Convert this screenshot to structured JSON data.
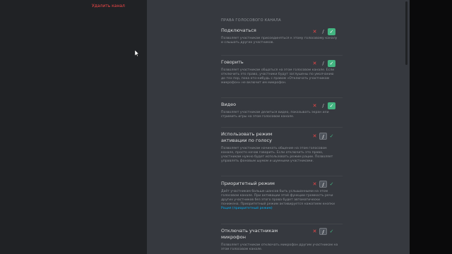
{
  "sidebar": {
    "delete_channel_label": "Удалить канал"
  },
  "section": {
    "title": "Права голосового канала"
  },
  "permissions": [
    {
      "title": "Подключаться",
      "description": "Позволяет участникам присоединяться к этому голосовому каналу и слышать других участников.",
      "state": "allow"
    },
    {
      "title": "Говорить",
      "description": "Позволяет участникам общаться на этом голосовом канале. Если отключить это право, участники будут заглушены по умолчанию до тех пор, пока кто-нибудь с правом «Отключать участникам микрофон» не включит им микрофон.",
      "state": "allow"
    },
    {
      "title": "Видео",
      "description": "Позволяет участникам делиться видео, показывать экран или стримить игры на этом голосовом канале.",
      "state": "allow"
    },
    {
      "title": "Использовать режим активации по голосу",
      "description": "Позволяет участникам начинать общение на этом голосовом канале, просто начав говорить. Если отключить это право, участникам нужно будет использовать режим рации. Позволяет управлять фоновым шумом и шумными участниками.",
      "state": "neutral"
    },
    {
      "title": "Приоритетный режим",
      "description": "Даёт участникам больше шансов быть услышанными на этом голосовом канале. При активации этой функции громкость речи других участников без этого права будет автоматически понижена. Приоритетный режим активируется нажатием кнопки",
      "link": "Рация (приоритетный режим)",
      "state": "neutral"
    },
    {
      "title": "Отключать участникам микрофон",
      "description": "Позволяет участникам отключать микрофон другим участникам на этом голосовом канале.",
      "state": "neutral"
    }
  ],
  "toggle_glyphs": {
    "deny": "✕",
    "neutral": "/",
    "allow": "✓"
  },
  "colors": {
    "deny": "#f04747",
    "allow": "#43b581",
    "link": "#00aff4",
    "background": "#36393f",
    "sidebar": "#202225"
  }
}
